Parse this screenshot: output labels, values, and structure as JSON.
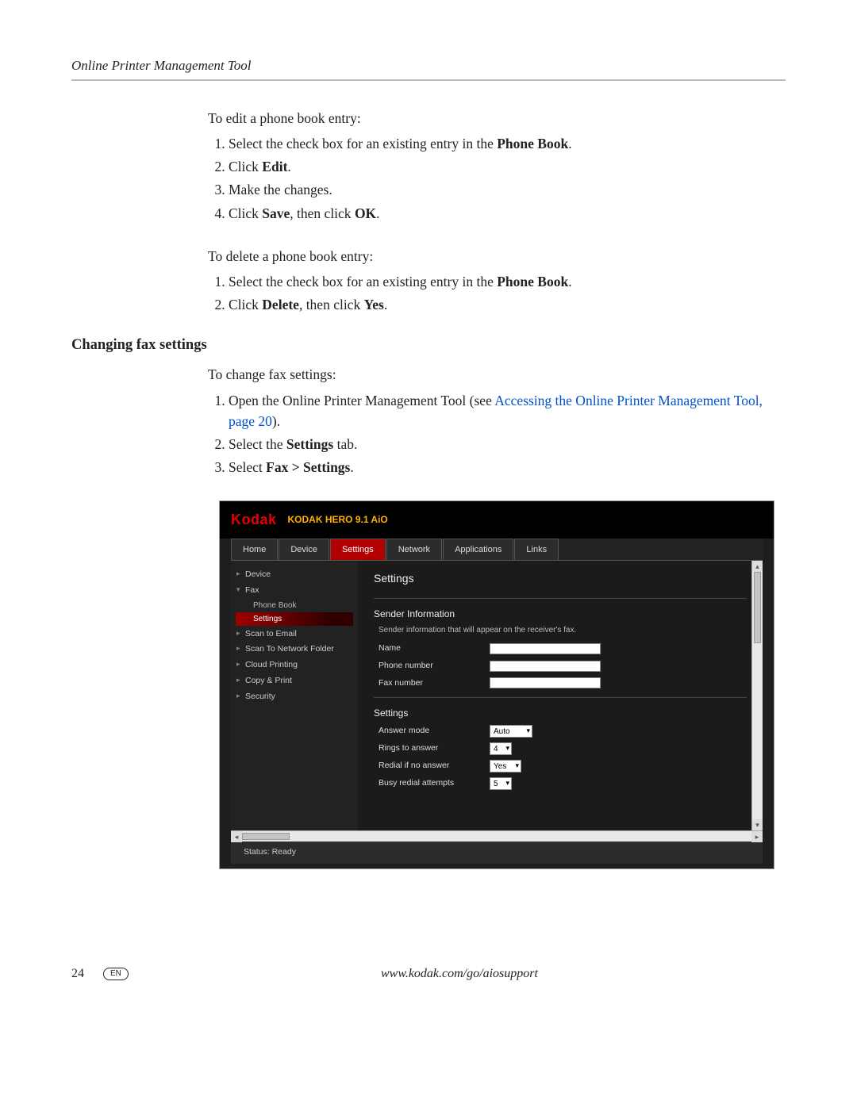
{
  "header": {
    "title": "Online Printer Management Tool"
  },
  "edit": {
    "intro": "To edit a phone book entry:",
    "s1_pre": "Select the check box for an existing entry in the ",
    "s1_b": "Phone Book",
    "s1_post": ".",
    "s2_pre": "Click ",
    "s2_b": "Edit",
    "s2_post": ".",
    "s3": "Make the changes.",
    "s4_pre": "Click ",
    "s4_b1": "Save",
    "s4_mid": ", then click ",
    "s4_b2": "OK",
    "s4_post": "."
  },
  "del": {
    "intro": "To delete a phone book entry:",
    "s1_pre": "Select the check box for an existing entry in the ",
    "s1_b": "Phone Book",
    "s1_post": ".",
    "s2_pre": "Click ",
    "s2_b1": "Delete",
    "s2_mid": ", then click ",
    "s2_b2": "Yes",
    "s2_post": "."
  },
  "section_heading": "Changing fax settings",
  "change": {
    "intro": "To change fax settings:",
    "s1_pre": "Open the Online Printer Management Tool (see ",
    "s1_link": "Accessing the Online Printer Management Tool, page 20",
    "s1_post": ").",
    "s2_pre": "Select the ",
    "s2_b": "Settings",
    "s2_post": " tab.",
    "s3_pre": "Select ",
    "s3_b": "Fax > Settings",
    "s3_post": "."
  },
  "shot": {
    "logo": "Kodak",
    "product": "KODAK HERO 9.1 AiO",
    "tabs": [
      "Home",
      "Device",
      "Settings",
      "Network",
      "Applications",
      "Links"
    ],
    "active_tab_index": 2,
    "sidebar": {
      "items": [
        {
          "label": "Device",
          "expanded": false
        },
        {
          "label": "Fax",
          "expanded": true,
          "children": [
            "Phone Book",
            "Settings"
          ],
          "selected_child": 1
        },
        {
          "label": "Scan to Email",
          "expanded": false
        },
        {
          "label": "Scan To Network Folder",
          "expanded": false
        },
        {
          "label": "Cloud Printing",
          "expanded": false
        },
        {
          "label": "Copy & Print",
          "expanded": false
        },
        {
          "label": "Security",
          "expanded": false
        }
      ]
    },
    "main": {
      "title": "Settings",
      "sender_group": "Sender Information",
      "sender_desc": "Sender information that will appear on the receiver's fax.",
      "name_label": "Name",
      "phone_label": "Phone number",
      "fax_label": "Fax number",
      "name_value": "",
      "phone_value": "",
      "fax_value": "",
      "settings_group": "Settings",
      "answer_mode_label": "Answer mode",
      "answer_mode_value": "Auto",
      "rings_label": "Rings to answer",
      "rings_value": "4",
      "redial_label": "Redial if no answer",
      "redial_value": "Yes",
      "busy_label": "Busy redial attempts",
      "busy_value": "5"
    },
    "status": "Status: Ready"
  },
  "footer": {
    "page": "24",
    "lang": "EN",
    "url": "www.kodak.com/go/aiosupport"
  }
}
